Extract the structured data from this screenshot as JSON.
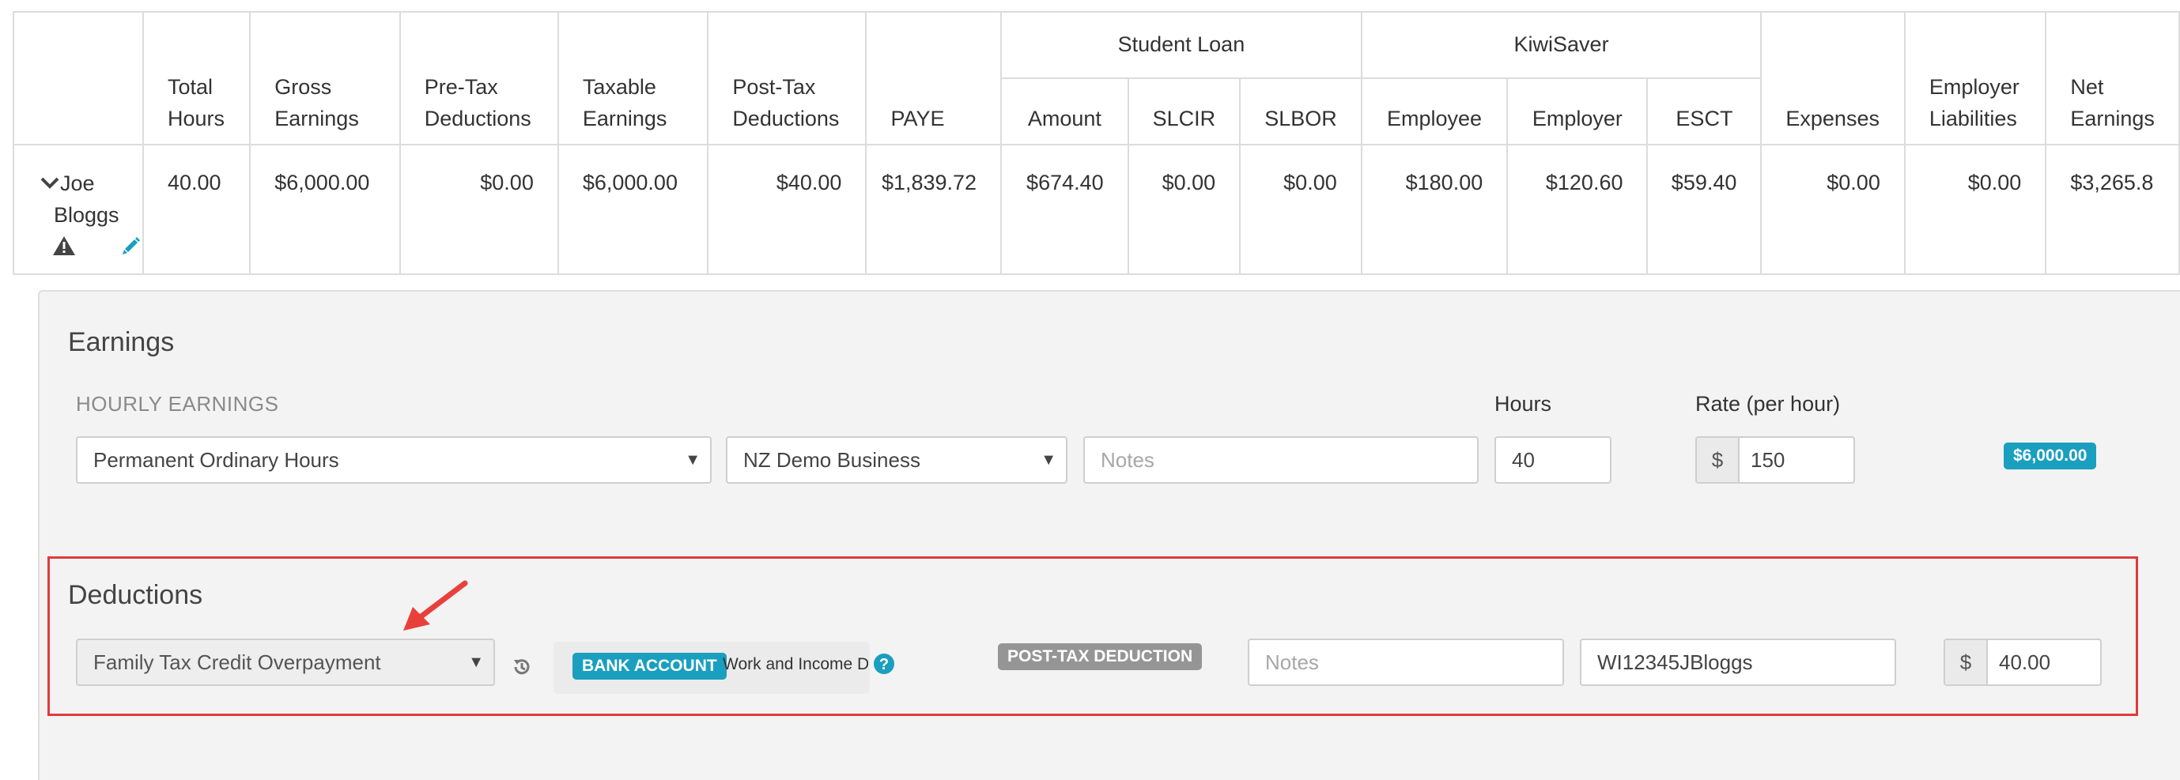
{
  "table": {
    "headers": {
      "total_hours": [
        "Total",
        "Hours"
      ],
      "gross_earnings": [
        "Gross",
        "Earnings"
      ],
      "pretax_deductions": [
        "Pre-Tax",
        "Deductions"
      ],
      "taxable_earnings": [
        "Taxable",
        "Earnings"
      ],
      "posttax_deductions": [
        "Post-Tax",
        "Deductions"
      ],
      "paye": "PAYE",
      "student_loan": "Student Loan",
      "student_loan_cols": [
        "Amount",
        "SLCIR",
        "SLBOR"
      ],
      "kiwisaver": "KiwiSaver",
      "kiwisaver_cols": [
        "Employee",
        "Employer",
        "ESCT"
      ],
      "expenses": "Expenses",
      "employer_liabilities": [
        "Employer",
        "Liabilities"
      ],
      "net_earnings": [
        "Net",
        "Earnings"
      ]
    },
    "row": {
      "employee_first": "Joe",
      "employee_last": "Bloggs",
      "total_hours": "40.00",
      "gross_earnings": "$6,000.00",
      "pretax_deductions": "$0.00",
      "taxable_earnings": "$6,000.00",
      "posttax_deductions": "$40.00",
      "paye": "$1,839.72",
      "sl_amount": "$674.40",
      "slcir": "$0.00",
      "slbor": "$0.00",
      "ks_employee": "$180.00",
      "ks_employer": "$120.60",
      "esct": "$59.40",
      "expenses": "$0.00",
      "employer_liabilities": "$0.00",
      "net_earnings": "$3,265.8"
    }
  },
  "earnings": {
    "title": "Earnings",
    "hourly_label": "HOURLY EARNINGS",
    "pay_category": "Permanent Ordinary Hours",
    "location": "NZ Demo Business",
    "notes_placeholder": "Notes",
    "hours_label": "Hours",
    "hours_value": "40",
    "rate_label": "Rate (per hour)",
    "currency_symbol": "$",
    "rate_value": "150",
    "total_badge": "$6,000.00"
  },
  "deductions": {
    "title": "Deductions",
    "category": "Family Tax Credit Overpayment",
    "bank_badge": "BANK ACCOUNT",
    "bank_text": "Work and Income D",
    "type_badge": "POST-TAX DEDUCTION",
    "notes_placeholder": "Notes",
    "reference_value": "WI12345JBloggs",
    "currency_symbol": "$",
    "amount_value": "40.00"
  },
  "colors": {
    "accent": "#1a9fbf",
    "highlight": "#e03a3a",
    "arrow": "#e8413c"
  },
  "icons": [
    "chevron-down-icon",
    "warning-icon",
    "pencil-icon",
    "history-icon",
    "help-icon",
    "arrow-icon"
  ]
}
